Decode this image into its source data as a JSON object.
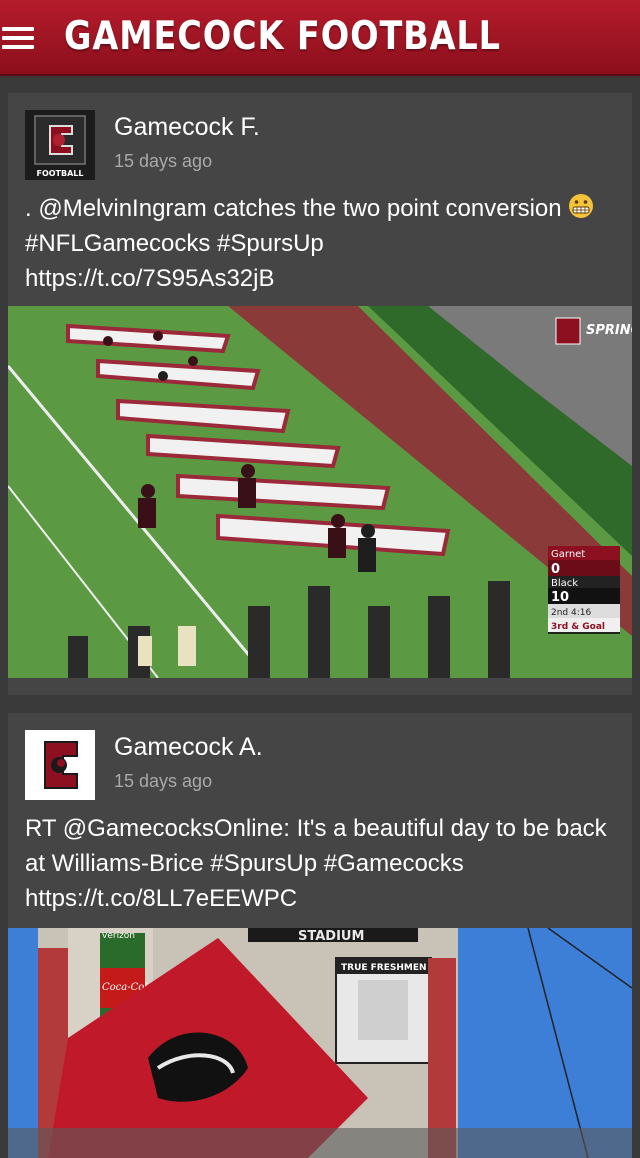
{
  "app": {
    "title": "GAMECOCK FOOTBALL"
  },
  "feed": [
    {
      "author": "Gamecock F.",
      "time": "15 days ago",
      "text_before_emoji": ". @MelvinIngram catches the two point conversion",
      "text_after_emoji": "#NFLGamecocks #SpursUp",
      "link": "https://t.co/7S95As32jB",
      "avatar_label": "FOOTBALL",
      "media": {
        "overlay_logo_text": "SPRING GAME",
        "scoreboard": {
          "team1": "Garnet",
          "score1": "0",
          "team2": "Black",
          "score2": "10",
          "clock": "2nd 4:16",
          "down": "3rd & Goal"
        }
      }
    },
    {
      "author": "Gamecock A.",
      "time": "15 days ago",
      "text": "RT @GamecocksOnline: It's a beautiful day to be back at Williams-Brice #SpursUp #Gamecocks",
      "link": "https://t.co/8LL7eEEWPC",
      "media": {
        "stadium_sign": "STADIUM",
        "board_title": "TRUE FRESHMEN",
        "sponsor": "Coca-Cola",
        "sponsor2": "verizon"
      }
    }
  ]
}
